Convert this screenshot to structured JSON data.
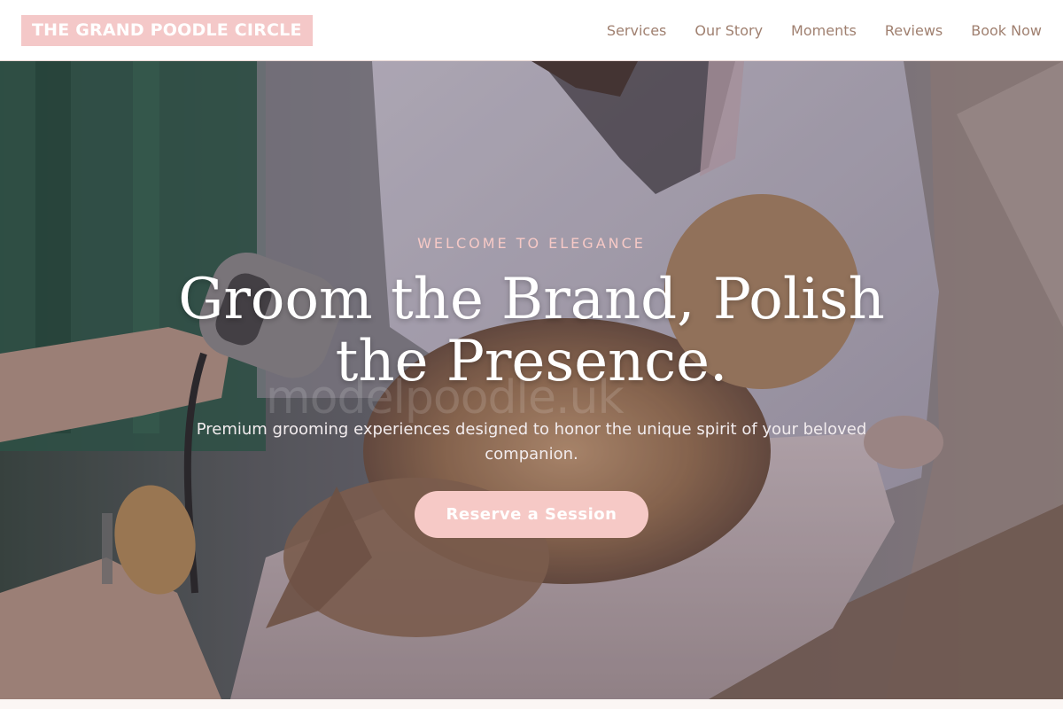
{
  "brand": {
    "logo_text": "THE GRAND POODLE CIRCLE"
  },
  "nav": {
    "items": [
      {
        "label": "Services"
      },
      {
        "label": "Our Story"
      },
      {
        "label": "Moments"
      },
      {
        "label": "Reviews"
      },
      {
        "label": "Book Now"
      }
    ]
  },
  "hero": {
    "eyebrow": "WELCOME TO ELEGANCE",
    "headline": "Groom the Brand, Polish the Presence.",
    "subtext": "Premium grooming experiences designed to honor the unique spirit of your beloved companion.",
    "cta_label": "Reserve a Session",
    "image_description": "groomer-drying-dog-photo",
    "watermark_text": "modelpoodle.uk"
  },
  "colors": {
    "accent_pink": "#f6c9c6",
    "logo_bg": "#f4c8c8",
    "nav_text": "#a08070",
    "page_bg": "#fbf6f4"
  }
}
